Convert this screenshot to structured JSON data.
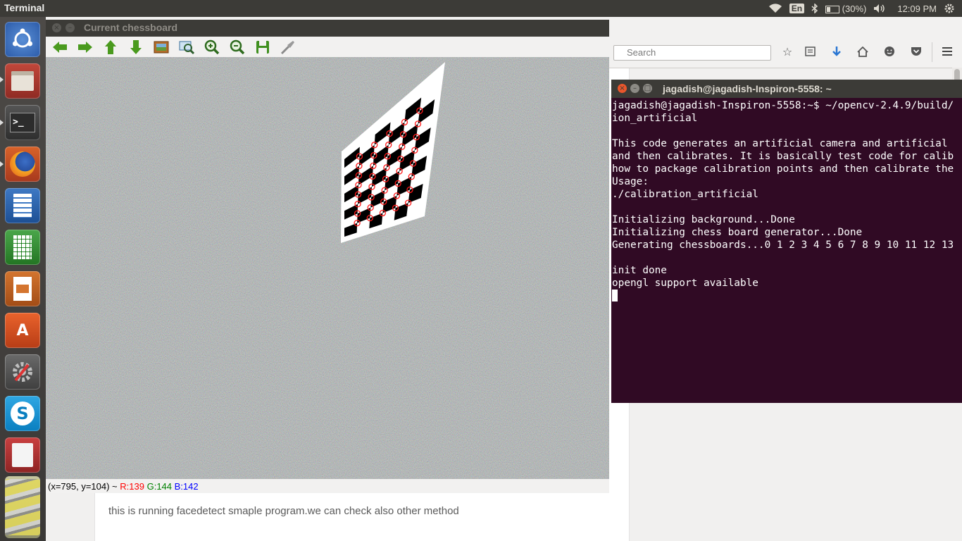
{
  "top_panel": {
    "app_title": "Terminal",
    "keyboard_layout": "En",
    "battery": "(30%)",
    "clock": "12:09 PM"
  },
  "launcher": {
    "items": [
      "ubuntu-dash-icon",
      "files-icon",
      "terminal-icon",
      "firefox-icon",
      "writer-icon",
      "calc-icon",
      "impress-icon",
      "software-center-icon",
      "system-settings-icon",
      "skype-icon",
      "app-icon",
      "workspaces-icon"
    ]
  },
  "browser": {
    "search_placeholder": "Search",
    "comment_text": "this is running facedetect smaple program.we can check also other method"
  },
  "cv_window": {
    "title": "Current chessboard",
    "toolbar": [
      "arrow-left-icon",
      "arrow-right-icon",
      "arrow-up-icon",
      "arrow-down-icon",
      "image-icon",
      "zoom-fit-icon",
      "zoom-in-icon",
      "zoom-out-icon",
      "save-icon",
      "properties-icon"
    ],
    "status_coords": "(x=795, y=104) ~ ",
    "status_r": "R:139",
    "status_g": "G:144",
    "status_b": "B:142",
    "colors": {
      "r": "#ff0000",
      "g": "#008000",
      "b": "#0000ff"
    }
  },
  "terminal": {
    "title": "jagadish@jagadish-Inspiron-5558: ~",
    "lines": [
      "jagadish@jagadish-Inspiron-5558:~$ ~/opencv-2.4.9/build/",
      "ion_artificial",
      "",
      "This code generates an artificial camera and artificial",
      "and then calibrates. It is basically test code for calib",
      "how to package calibration points and then calibrate the",
      "Usage:",
      "./calibration_artificial",
      "",
      "Initializing background...Done",
      "Initializing chess board generator...Done",
      "Generating chessboards...0 1 2 3 4 5 6 7 8 9 10 11 12 13",
      "",
      "init done",
      "opengl support available"
    ]
  }
}
